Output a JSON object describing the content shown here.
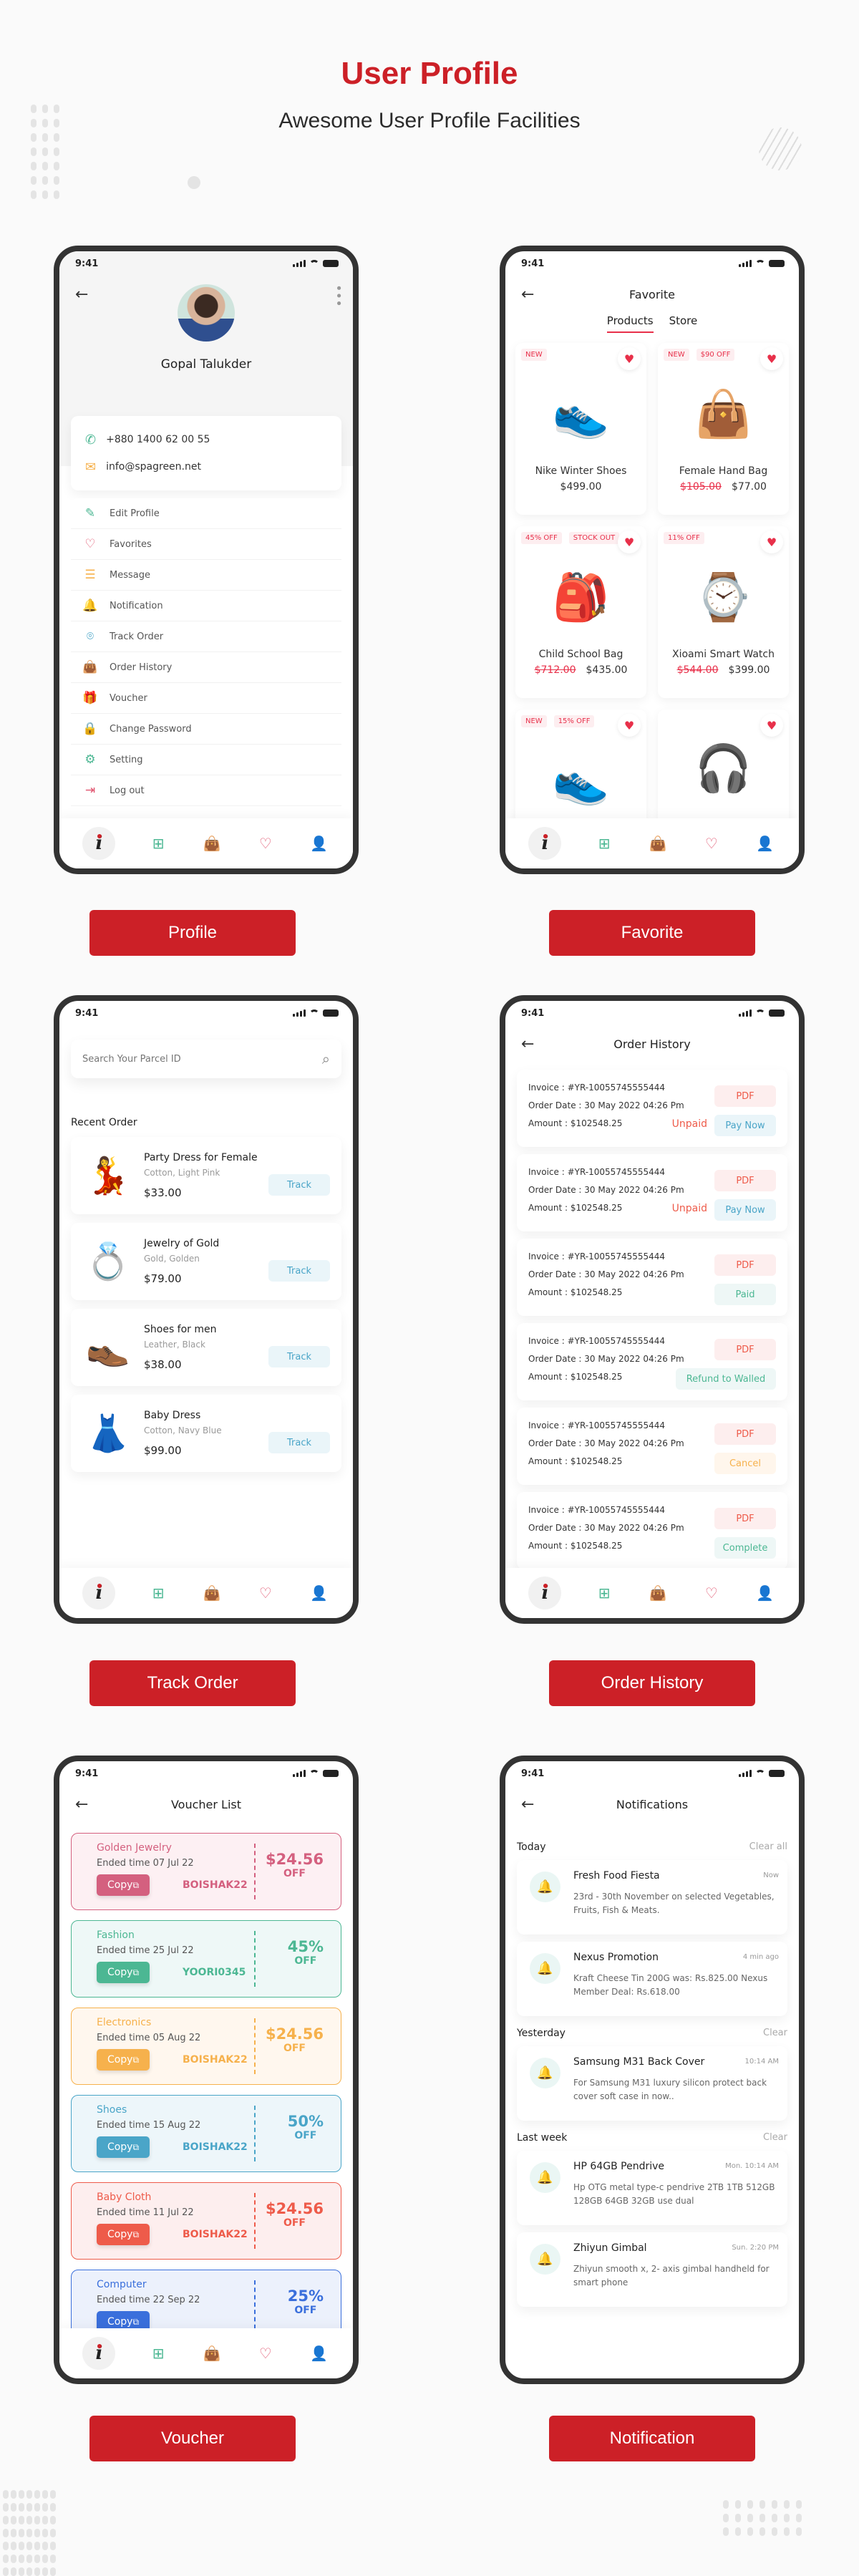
{
  "header": {
    "title": "User Profile",
    "subtitle": "Awesome User Profile Facilities"
  },
  "colors": {
    "brand": "#cc2027",
    "accent_pink": "#e8304a",
    "frame": "#333333"
  },
  "status_bar": {
    "time": "9:41"
  },
  "bottom_nav": {
    "items": [
      "home-logo-icon",
      "grid-icon",
      "bag-icon",
      "heart-icon",
      "user-icon"
    ]
  },
  "screen_labels": [
    "Profile",
    "Favorite",
    "Track Order",
    "Order History",
    "Voucher",
    "Notification"
  ],
  "profile": {
    "name": "Gopal Talukder",
    "phone": "+880 1400 62 00 55",
    "email": "info@spagreen.net",
    "menu": [
      {
        "label": "Edit Profile",
        "icon": "pencil-icon",
        "glyph": "✎",
        "color": "#4cb793"
      },
      {
        "label": "Favorites",
        "icon": "heart-icon",
        "glyph": "♡",
        "color": "#e0536e"
      },
      {
        "label": "Message",
        "icon": "message-icon",
        "glyph": "☰",
        "color": "#f6b14c"
      },
      {
        "label": "Notification",
        "icon": "bell-icon",
        "glyph": "🔔",
        "color": "#4cb793"
      },
      {
        "label": "Track Order",
        "icon": "location-pin-icon",
        "glyph": "⌾",
        "color": "#4aa5c8"
      },
      {
        "label": "Order History",
        "icon": "shopping-bag-icon",
        "glyph": "👜",
        "color": "#3a6fdc"
      },
      {
        "label": "Voucher",
        "icon": "gift-icon",
        "glyph": "🎁",
        "color": "#e0536e"
      },
      {
        "label": "Change Password",
        "icon": "lock-icon",
        "glyph": "🔒",
        "color": "#f6b14c"
      },
      {
        "label": "Setting",
        "icon": "gear-icon",
        "glyph": "⚙",
        "color": "#4cb793"
      },
      {
        "label": "Log out",
        "icon": "logout-icon",
        "glyph": "⇥",
        "color": "#e0536e"
      }
    ]
  },
  "favorite": {
    "title": "Favorite",
    "tabs": [
      "Products",
      "Store"
    ],
    "active_tab": "Products",
    "products": [
      {
        "name": "Nike Winter Shoes",
        "price": "$499.00",
        "old_price": "",
        "badges": [
          "NEW"
        ],
        "glyph": "👟"
      },
      {
        "name": "Female Hand Bag",
        "price": "$77.00",
        "old_price": "$105.00",
        "badges": [
          "NEW",
          "$90 OFF"
        ],
        "glyph": "👜"
      },
      {
        "name": "Child School Bag",
        "price": "$435.00",
        "old_price": "$712.00",
        "badges": [
          "45% OFF",
          "STOCK OUT"
        ],
        "glyph": "🎒"
      },
      {
        "name": "Xioami Smart Watch",
        "price": "$399.00",
        "old_price": "$544.00",
        "badges": [
          "11% OFF"
        ],
        "glyph": "⌚"
      },
      {
        "name": "",
        "price": "",
        "old_price": "",
        "badges": [
          "NEW",
          "15% OFF"
        ],
        "glyph": "👟"
      },
      {
        "name": "",
        "price": "",
        "old_price": "",
        "badges": [],
        "glyph": "🎧"
      }
    ]
  },
  "track": {
    "search_placeholder": "Search Your Parcel ID",
    "section_title": "Recent Order",
    "track_label": "Track",
    "orders": [
      {
        "name": "Party Dress for Female",
        "variant": "Cotton, Light Pink",
        "price": "$33.00",
        "glyph": "💃"
      },
      {
        "name": "Jewelry of Gold",
        "variant": "Gold, Golden",
        "price": "$79.00",
        "glyph": "💍"
      },
      {
        "name": "Shoes for men",
        "variant": "Leather, Black",
        "price": "$38.00",
        "glyph": "👞"
      },
      {
        "name": "Baby Dress",
        "variant": "Cotton, Navy Blue",
        "price": "$99.00",
        "glyph": "👗"
      }
    ]
  },
  "history": {
    "title": "Order History",
    "pdf_label": "PDF",
    "invoices": [
      {
        "invoice": "Invoice : #YR-10055745555444",
        "date": "Order Date :  30 May 2022 04:26 Pm",
        "amount": "Amount : $102548.25",
        "note": "Unpaid",
        "action": "Pay Now",
        "action_bg": "#eaf5f9",
        "action_fg": "#4aa5c8"
      },
      {
        "invoice": "Invoice : #YR-10055745555444",
        "date": "Order Date :  30 May 2022 04:26 Pm",
        "amount": "Amount : $102548.25",
        "note": "Unpaid",
        "action": "Pay Now",
        "action_bg": "#eaf5f9",
        "action_fg": "#4aa5c8"
      },
      {
        "invoice": "Invoice : #YR-10055745555444",
        "date": "Order Date :  30 May 2022 04:26 Pm",
        "amount": "Amount : $102548.25",
        "note": "",
        "action": "Paid",
        "action_bg": "#eef7f6",
        "action_fg": "#4cb793"
      },
      {
        "invoice": "Invoice : #YR-10055745555444",
        "date": "Order Date :  30 May 2022 04:26 Pm",
        "amount": "Amount : $102548.25",
        "note": "",
        "action": "Refund to Walled",
        "action_bg": "#eef7f6",
        "action_fg": "#4cb793"
      },
      {
        "invoice": "Invoice : #YR-10055745555444",
        "date": "Order Date :  30 May 2022 04:26 Pm",
        "amount": "Amount : $102548.25",
        "note": "",
        "action": "Cancel",
        "action_bg": "#fff6ec",
        "action_fg": "#f6b14c"
      },
      {
        "invoice": "Invoice : #YR-10055745555444",
        "date": "Order Date :  30 May 2022 04:26 Pm",
        "amount": "Amount : $102548.25",
        "note": "",
        "action": "Complete",
        "action_bg": "#eef7f6",
        "action_fg": "#4cb793"
      }
    ]
  },
  "voucher": {
    "title": "Voucher List",
    "copy_label": "Copy",
    "items": [
      {
        "category": "Golden Jewelry",
        "ended": "Ended time 07 Jul 22",
        "code": "BOISHAK22",
        "value": "$24.56",
        "off": "OFF",
        "color": "#d4607f",
        "bg": "#fdf0f3"
      },
      {
        "category": "Fashion",
        "ended": "Ended time 25 Jul 22",
        "code": "YOORI0345",
        "value": "45%",
        "off": "OFF",
        "color": "#4cb793",
        "bg": "#eef8f7"
      },
      {
        "category": "Electronics",
        "ended": "Ended time 05 Aug 22",
        "code": "BOISHAK22",
        "value": "$24.56",
        "off": "OFF",
        "color": "#f6b14c",
        "bg": "#fff7ee"
      },
      {
        "category": "Shoes",
        "ended": "Ended time 15 Aug 22",
        "code": "BOISHAK22",
        "value": "50%",
        "off": "OFF",
        "color": "#4aa5c8",
        "bg": "#edf6fa"
      },
      {
        "category": "Baby Cloth",
        "ended": "Ended time 11 Jul 22",
        "code": "BOISHAK22",
        "value": "$24.56",
        "off": "OFF",
        "color": "#ee5b4a",
        "bg": "#fdeeee"
      },
      {
        "category": "Computer",
        "ended": "Ended time 22 Sep 22",
        "code": "",
        "value": "25%",
        "off": "OFF",
        "color": "#3a6fdc",
        "bg": "#ecf1fc"
      }
    ]
  },
  "notifications": {
    "title": "Notifications",
    "groups": [
      {
        "label": "Today",
        "clear": "Clear all",
        "items": [
          {
            "title": "Fresh Food Fiesta",
            "time": "Now",
            "body": "23rd - 30th November on selected Vegetables, Fruits, Fish & Meats."
          },
          {
            "title": "Nexus Promotion",
            "time": "4 min ago",
            "body": "Kraft Cheese Tin 200G was: Rs.825.00 Nexus Member Deal: Rs.618.00"
          }
        ]
      },
      {
        "label": "Yesterday",
        "clear": "Clear",
        "items": [
          {
            "title": "Samsung M31 Back Cover",
            "time": "10:14 AM",
            "body": "For Samsung M31 luxury silicon protect back cover soft case in now.."
          }
        ]
      },
      {
        "label": "Last week",
        "clear": "Clear",
        "items": [
          {
            "title": "HP 64GB Pendrive",
            "time": "Mon. 10:14 AM",
            "body": "Hp OTG metal type-c pendrive 2TB 1TB 512GB 128GB 64GB 32GB use dual"
          },
          {
            "title": "Zhiyun Gimbal",
            "time": "Sun. 2:20 PM",
            "body": "Zhiyun smooth x, 2- axis gimbal handheld for smart phone"
          }
        ]
      }
    ]
  }
}
